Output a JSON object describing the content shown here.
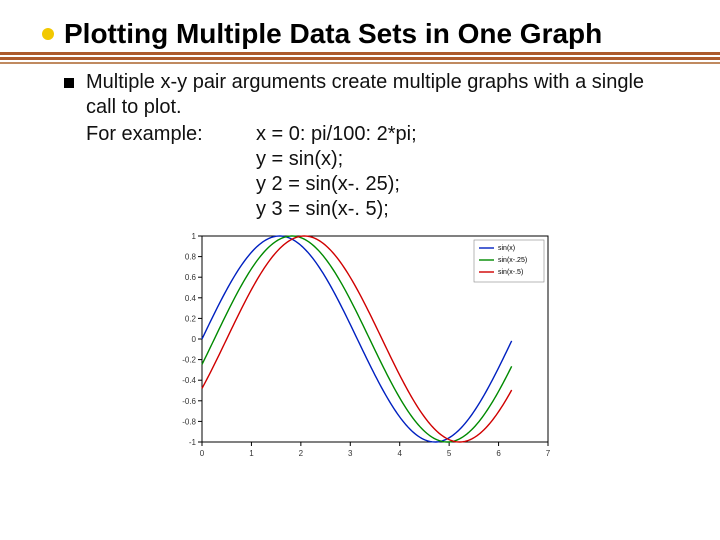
{
  "title": "Plotting Multiple Data Sets in One Graph",
  "bullet_text": "Multiple x-y pair arguments create multiple graphs with a single call to plot.",
  "example_label": "For example:",
  "code": {
    "l1": "x = 0: pi/100: 2*pi;",
    "l2": "y = sin(x);",
    "l3": "y 2 = sin(x-. 25);",
    "l4": "y 3 = sin(x-. 5);"
  },
  "chart_data": {
    "type": "line",
    "xlabel": "",
    "ylabel": "",
    "xlim": [
      0,
      7
    ],
    "ylim": [
      -1,
      1
    ],
    "xticks": [
      0,
      1,
      2,
      3,
      4,
      5,
      6,
      7
    ],
    "yticks": [
      -1,
      -0.8,
      -0.6,
      -0.4,
      -0.2,
      0,
      0.2,
      0.4,
      0.6,
      0.8,
      1
    ],
    "legend": [
      "sin(x)",
      "sin(x-.25)",
      "sin(x-.5)"
    ],
    "colors": [
      "#0020c0",
      "#008a00",
      "#d00000"
    ],
    "series": [
      {
        "name": "sin(x)",
        "shift": 0
      },
      {
        "name": "sin(x-.25)",
        "shift": 0.25
      },
      {
        "name": "sin(x-.5)",
        "shift": 0.5
      }
    ]
  }
}
